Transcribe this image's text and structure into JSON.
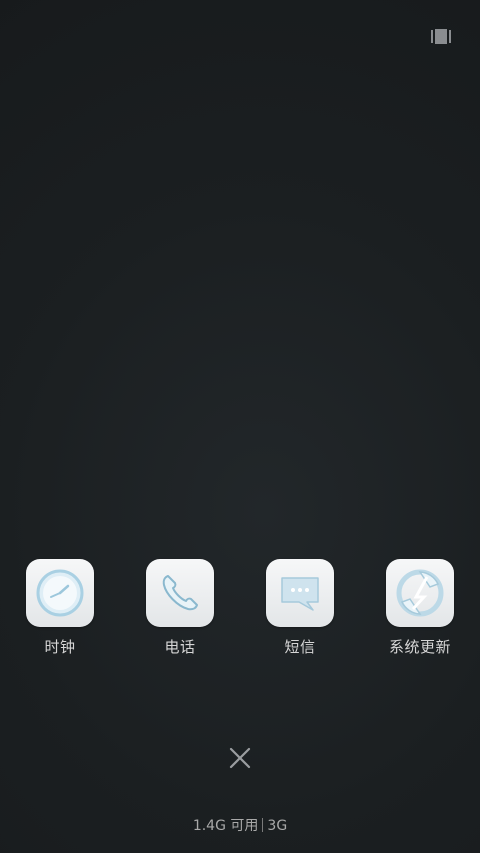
{
  "top_right": {
    "icon": "view-toggle-icon"
  },
  "recent_apps": [
    {
      "label": "时钟",
      "icon": "clock-icon"
    },
    {
      "label": "电话",
      "icon": "phone-icon"
    },
    {
      "label": "短信",
      "icon": "messages-icon"
    },
    {
      "label": "系统更新",
      "icon": "system-update-icon"
    }
  ],
  "close_button": {
    "icon": "close-icon"
  },
  "memory_status": {
    "available": "1.4G 可用",
    "total": "3G"
  },
  "colors": {
    "background": "#1b1f21",
    "icon_tile": "#eef0f1",
    "icon_glyph": "#9fc9dd",
    "label_text": "#d6d6d6"
  }
}
